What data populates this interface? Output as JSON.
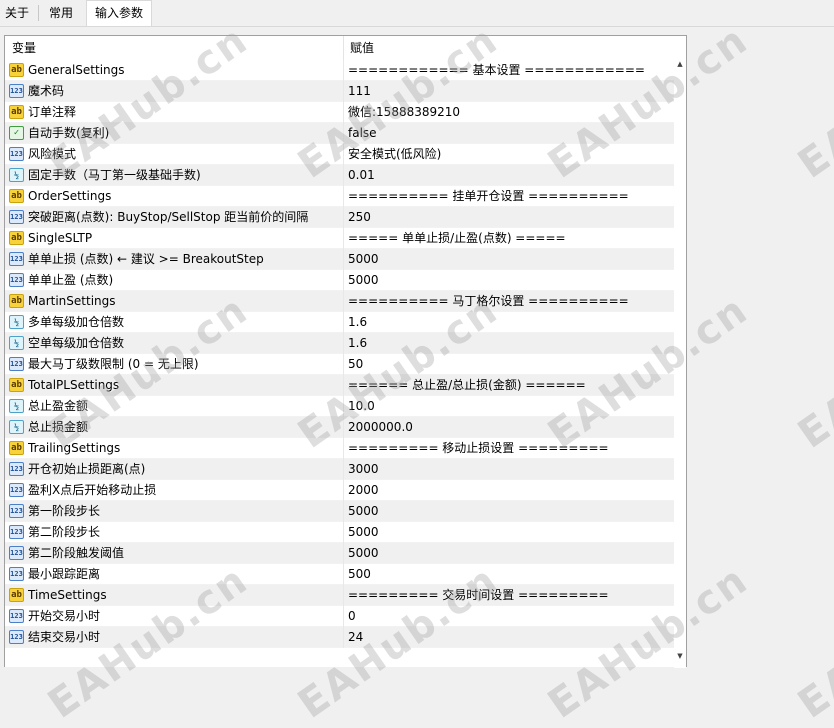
{
  "tabs": [
    {
      "label": "关于",
      "active": false
    },
    {
      "label": "常用",
      "active": false
    },
    {
      "label": "输入参数",
      "active": true
    }
  ],
  "grid": {
    "header_variable": "变量",
    "header_value": "赋值"
  },
  "params": [
    {
      "icon": "ab",
      "name": "GeneralSettings",
      "value": "============ 基本设置 ============"
    },
    {
      "icon": "123",
      "name": "魔术码",
      "value": "111"
    },
    {
      "icon": "ab",
      "name": "订单注释",
      "value": "微信:15888389210"
    },
    {
      "icon": "bool",
      "name": "自动手数(复利)",
      "value": "false"
    },
    {
      "icon": "123",
      "name": "风险模式",
      "value": "安全模式(低风险)"
    },
    {
      "icon": "frac",
      "name": "固定手数（马丁第一级基础手数)",
      "value": "0.01"
    },
    {
      "icon": "ab",
      "name": "OrderSettings",
      "value": "========== 挂单开仓设置 =========="
    },
    {
      "icon": "123",
      "name": "突破距离(点数): BuyStop/SellStop 距当前价的间隔",
      "value": "250"
    },
    {
      "icon": "ab",
      "name": "SingleSLTP",
      "value": "===== 单单止损/止盈(点数) ====="
    },
    {
      "icon": "123",
      "name": "单单止损 (点数) ← 建议 >= BreakoutStep",
      "value": "5000"
    },
    {
      "icon": "123",
      "name": "单单止盈 (点数)",
      "value": "5000"
    },
    {
      "icon": "ab",
      "name": "MartinSettings",
      "value": "========== 马丁格尔设置 =========="
    },
    {
      "icon": "frac",
      "name": "多单每级加仓倍数",
      "value": "1.6"
    },
    {
      "icon": "frac",
      "name": "空单每级加仓倍数",
      "value": "1.6"
    },
    {
      "icon": "123",
      "name": "最大马丁级数限制 (0 = 无上限)",
      "value": "50"
    },
    {
      "icon": "ab",
      "name": "TotalPLSettings",
      "value": "====== 总止盈/总止损(金额) ======"
    },
    {
      "icon": "frac",
      "name": "总止盈金额",
      "value": "10.0"
    },
    {
      "icon": "frac",
      "name": "总止损金额",
      "value": "2000000.0"
    },
    {
      "icon": "ab",
      "name": "TrailingSettings",
      "value": "========= 移动止损设置 ========="
    },
    {
      "icon": "123",
      "name": "开仓初始止损距离(点)",
      "value": "3000"
    },
    {
      "icon": "123",
      "name": "盈利X点后开始移动止损",
      "value": "2000"
    },
    {
      "icon": "123",
      "name": "第一阶段步长",
      "value": "5000"
    },
    {
      "icon": "123",
      "name": "第二阶段步长",
      "value": "5000"
    },
    {
      "icon": "123",
      "name": "第二阶段触发阈值",
      "value": "5000"
    },
    {
      "icon": "123",
      "name": "最小跟踪距离",
      "value": "500"
    },
    {
      "icon": "ab",
      "name": "TimeSettings",
      "value": "========= 交易时间设置 ========="
    },
    {
      "icon": "123",
      "name": "开始交易小时",
      "value": "0"
    },
    {
      "icon": "123",
      "name": "结束交易小时",
      "value": "24"
    }
  ],
  "icon_text": {
    "ab": "ab",
    "123": "123",
    "frac": "½",
    "bool": "✓"
  },
  "watermark_text": "EAHub.cn"
}
